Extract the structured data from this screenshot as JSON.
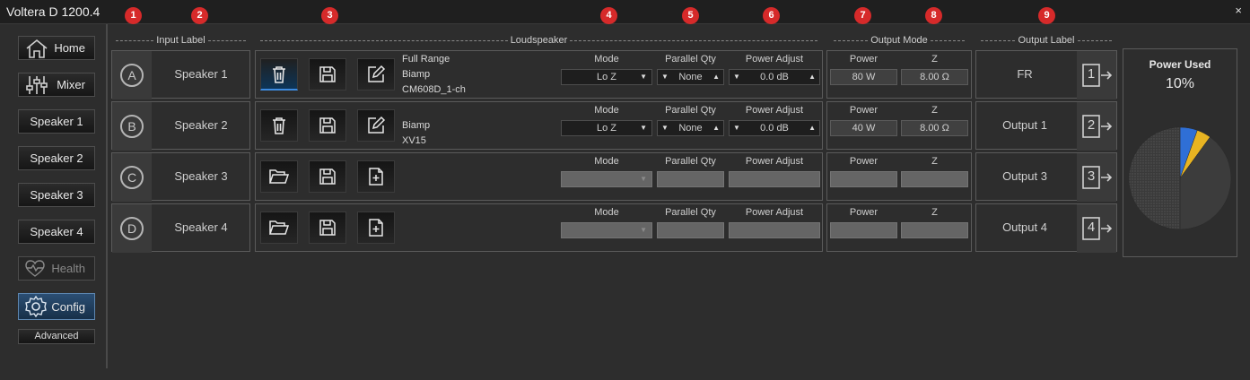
{
  "window": {
    "title": "Voltera D 1200.4",
    "close_glyph": "×"
  },
  "badges": [
    "1",
    "2",
    "3",
    "4",
    "5",
    "6",
    "7",
    "8",
    "9"
  ],
  "sidebar": {
    "home": "Home",
    "mixer": "Mixer",
    "speakers": [
      "Speaker 1",
      "Speaker 2",
      "Speaker 3",
      "Speaker 4"
    ],
    "health": "Health",
    "config": "Config",
    "advanced": "Advanced"
  },
  "sections": {
    "input_label": "Input Label",
    "loudspeaker": "Loudspeaker",
    "output_mode": "Output Mode",
    "output_label": "Output Label"
  },
  "column_labels": {
    "mode": "Mode",
    "parallel_qty": "Parallel Qty",
    "power_adjust": "Power Adjust",
    "power": "Power",
    "z": "Z"
  },
  "channels": [
    {
      "letter": "A",
      "input_label": "Speaker 1",
      "tools": [
        "trash-icon",
        "save-icon",
        "edit-icon"
      ],
      "info": [
        "Full Range",
        "Biamp",
        "CM608D_1-ch"
      ],
      "mode": "Lo Z",
      "parallel_qty": "None",
      "power_adjust": "0.0 dB",
      "power": "80 W",
      "z": "8.00 Ω",
      "output_label": "FR",
      "output_num": "1"
    },
    {
      "letter": "B",
      "input_label": "Speaker 2",
      "tools": [
        "trash-icon",
        "save-icon",
        "edit-icon"
      ],
      "info": [
        "Biamp",
        "XV15"
      ],
      "mode": "Lo Z",
      "parallel_qty": "None",
      "power_adjust": "0.0 dB",
      "power": "40 W",
      "z": "8.00 Ω",
      "output_label": "Output 1",
      "output_num": "2"
    },
    {
      "letter": "C",
      "input_label": "Speaker 3",
      "tools": [
        "folder-open-icon",
        "save-icon",
        "new-file-icon"
      ],
      "info": [],
      "mode": "",
      "parallel_qty": "",
      "power_adjust": "",
      "power": "",
      "z": "",
      "output_label": "Output 3",
      "output_num": "3"
    },
    {
      "letter": "D",
      "input_label": "Speaker 4",
      "tools": [
        "folder-open-icon",
        "save-icon",
        "new-file-icon"
      ],
      "info": [],
      "mode": "",
      "parallel_qty": "",
      "power_adjust": "",
      "power": "",
      "z": "",
      "output_label": "Output 4",
      "output_num": "4"
    }
  ],
  "power_used": {
    "title": "Power Used",
    "value": "10%",
    "colors": {
      "used_blue": "#2f6fd6",
      "used_yellow": "#e8b422",
      "unused": "#3c3c3c",
      "unused_pattern": "#4a4a4a"
    }
  },
  "colors": {
    "badge": "#d62a2a",
    "accent": "#3d8be0"
  }
}
